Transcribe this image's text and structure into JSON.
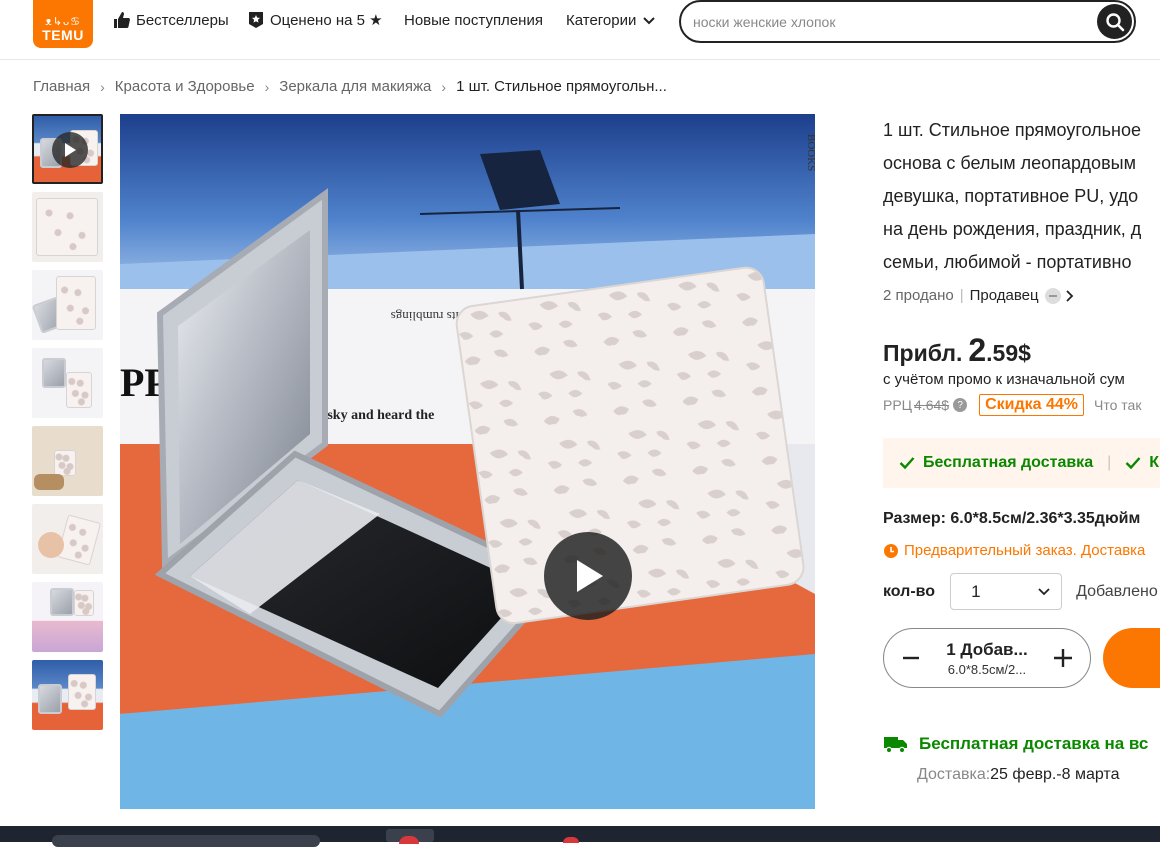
{
  "header": {
    "logo_text": "TEMU",
    "logo_glyphs": "ᴥ↳ᴗ♋",
    "nav": [
      {
        "label": "Бестселлеры",
        "icon": "thumbs-up-icon"
      },
      {
        "label": "Оценено на 5 ★",
        "icon": "star-badge-icon"
      },
      {
        "label": "Новые поступления"
      },
      {
        "label": "Категории",
        "icon": "chevron-down-icon"
      }
    ],
    "search_placeholder": "носки женские хлопок"
  },
  "breadcrumb": [
    "Главная",
    "Красота и Здоровье",
    "Зеркала для макияжа",
    "1 шт. Стильное прямоугольн..."
  ],
  "product": {
    "title_lines": [
      "1 шт. Стильное прямоугольное",
      "основа с белым леопардовым",
      "девушка, портативное PU, удо",
      "на день рождения, праздник, д",
      "семьи, любимой - портативно"
    ],
    "sold": "2 продано",
    "seller": "Продавец",
    "price_prefix": "Прибл.",
    "price_int": "2",
    "price_frac": ".59$",
    "promo_note": "с учётом промо к изначальной сум",
    "rrp_label": "РРЦ",
    "rrp_old": "4.64$",
    "discount": "Скидка 44%",
    "rrp_tail": "Что так",
    "shipping_badges": [
      "Бесплатная доставка",
      "К"
    ],
    "size": "Размер: 6.0*8.5см/2.36*3.35дюйм",
    "preorder": "Предварительный заказ. Доставка",
    "qty_label": "кол-во",
    "qty_value": "1",
    "added_text": "Добавлено",
    "stepper_main": "1 Добав...",
    "stepper_sub": "6.0*8.5см/2...",
    "free_shipping_line": "Бесплатная доставка на вс",
    "delivery_label": "Доставка:",
    "delivery_value": "25 февр.-8 марта"
  },
  "colors": {
    "brand": "#fb7701",
    "green": "#0a8800"
  }
}
